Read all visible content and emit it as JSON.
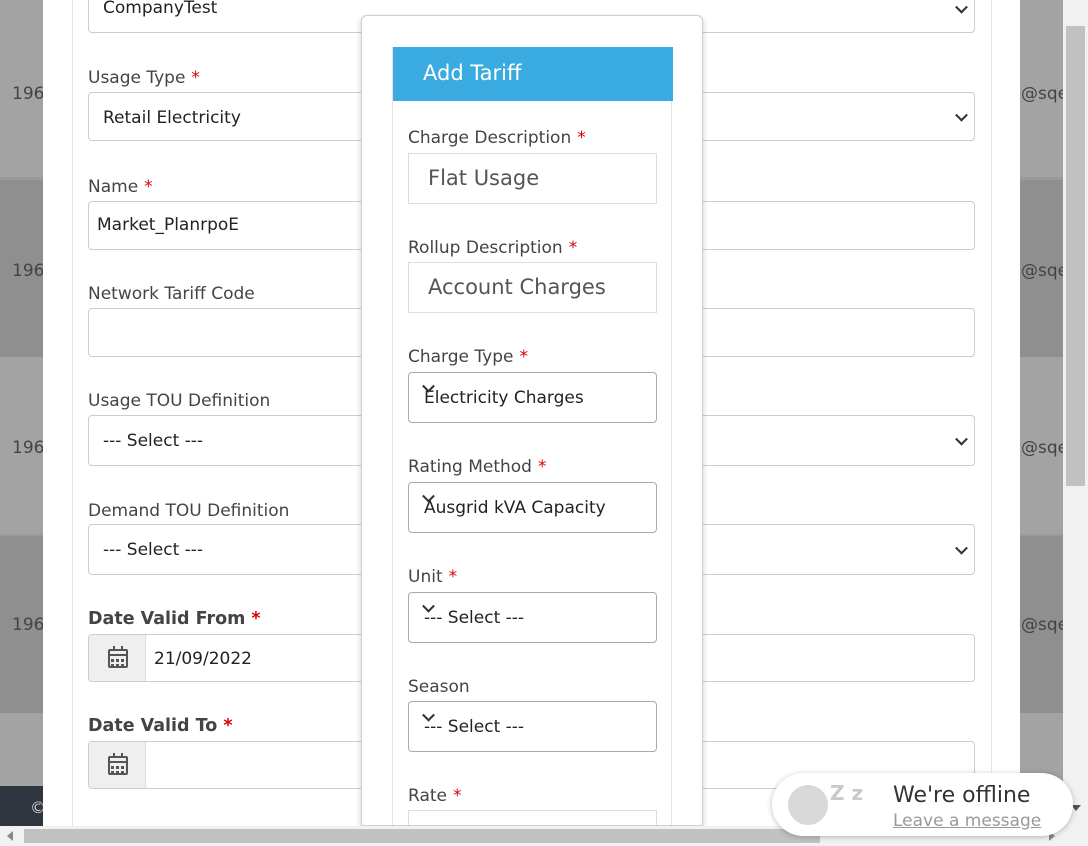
{
  "background": {
    "row_ids": [
      "196",
      "196",
      "196",
      "196"
    ],
    "row_emails": [
      "@sqe",
      "@sqe",
      "@sqe",
      "@sqe"
    ],
    "footer_text": "©"
  },
  "plan_form": {
    "company_value": "CompanyTest",
    "usage_type": {
      "label": "Usage Type",
      "value": "Retail Electricity"
    },
    "name": {
      "label": "Name",
      "value": "Market_PlanrpoE"
    },
    "network_tariff_code": {
      "label": "Network Tariff Code",
      "value": ""
    },
    "usage_tou": {
      "label": "Usage TOU Definition",
      "value": "--- Select ---"
    },
    "demand_tou": {
      "label": "Demand TOU Definition",
      "value": "--- Select ---"
    },
    "date_valid_from": {
      "label": "Date Valid From",
      "value": "21/09/2022"
    },
    "date_valid_to": {
      "label": "Date Valid To",
      "value": ""
    },
    "required_marker": "*"
  },
  "add_tariff": {
    "title": "Add Tariff",
    "charge_description": {
      "label": "Charge Description",
      "value": "Flat Usage"
    },
    "rollup_description": {
      "label": "Rollup Description",
      "value": "Account Charges"
    },
    "charge_type": {
      "label": "Charge Type",
      "value": "Electricity Charges"
    },
    "rating_method": {
      "label": "Rating Method",
      "value": "Ausgrid kVA Capacity"
    },
    "unit": {
      "label": "Unit",
      "value": "--- Select ---"
    },
    "season": {
      "label": "Season",
      "value": "--- Select ---"
    },
    "rate": {
      "label": "Rate",
      "value": ""
    }
  },
  "chat": {
    "title": "We're offline",
    "link": "Leave a message",
    "zz": "Z z"
  },
  "colors": {
    "accent": "#3aabe0",
    "required": "#dd0000"
  }
}
